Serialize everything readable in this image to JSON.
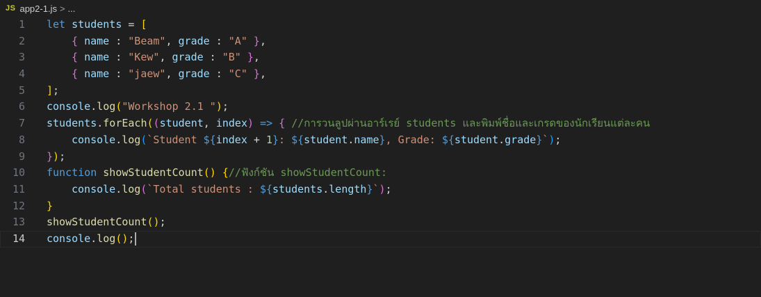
{
  "breadcrumb": {
    "lang_badge": "JS",
    "file": "app2-1.js",
    "separator": ">",
    "more": "..."
  },
  "editor": {
    "active_line": 14,
    "line_numbers": [
      "1",
      "2",
      "3",
      "4",
      "5",
      "6",
      "7",
      "8",
      "9",
      "10",
      "11",
      "12",
      "13",
      "14"
    ],
    "students": [
      {
        "name": "\"Beam\"",
        "grade": "\"A\""
      },
      {
        "name": "\"Kew\"",
        "grade": "\"B\""
      },
      {
        "name": "\"jaew\"",
        "grade": "\"C\""
      }
    ],
    "workshop_string": "\"Workshop 2.1 \"",
    "comment_foreach": "//การวนลูปผ่านอาร์เรย์ students และพิมพ์ชื่อและเกรดของนักเรียนแต่ละคน",
    "comment_function": "//ฟังก์ชัน showStudentCount:",
    "template_student_prefix": "`Student ",
    "template_total_prefix": "`Total students : ",
    "grade_label": ", Grade: ",
    "colon_space": ": "
  }
}
